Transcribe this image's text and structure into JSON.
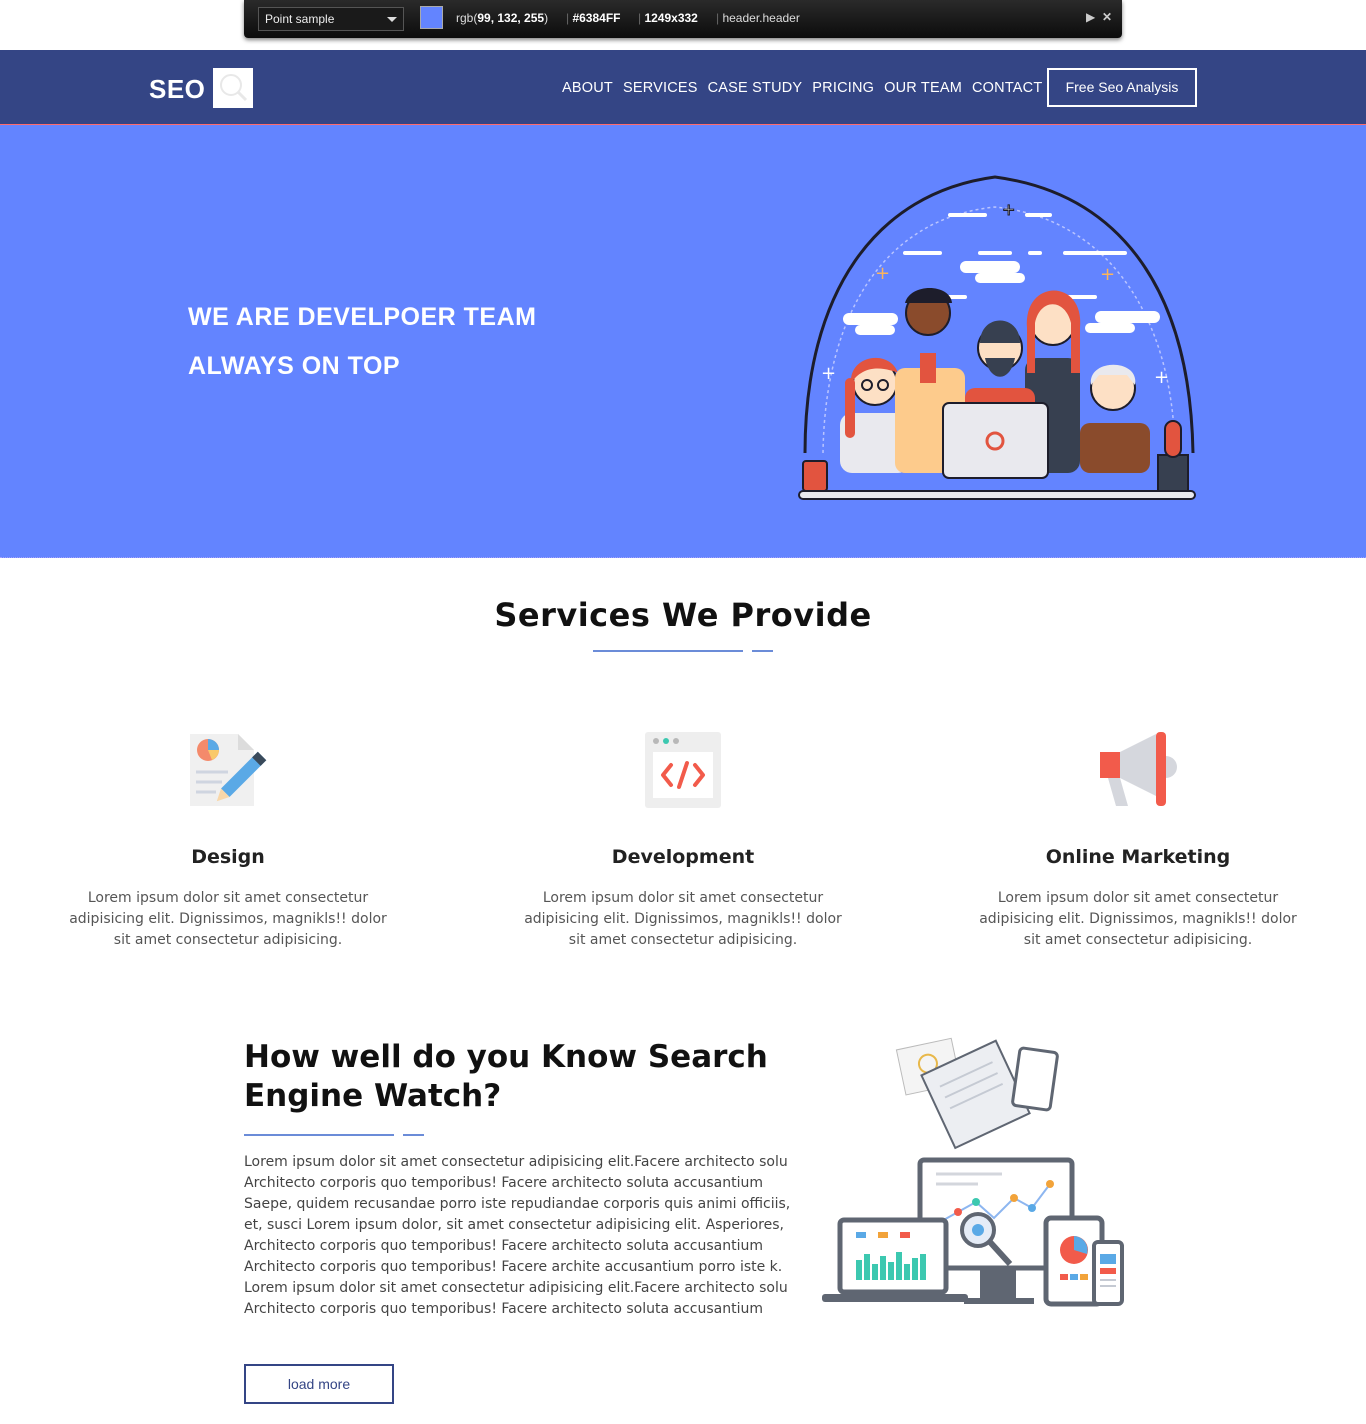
{
  "picker": {
    "mode": "Point sample",
    "rgb_prefix": "rgb(",
    "rgb_values": "99, 132, 255",
    "rgb_suffix": ")",
    "hex": "#6384FF",
    "size": "1249x332",
    "selector": "header.header",
    "swatch_color": "#6384FF"
  },
  "header": {
    "logo": "SEO",
    "nav": [
      "ABOUT",
      "SERVICES",
      "CASE STUDY",
      "PRICING",
      "OUR TEAM",
      "CONTACT"
    ],
    "cta": "Free Seo Analysis",
    "bg_color": "#344585"
  },
  "hero": {
    "line1": "WE ARE DEVELPOER TEAM",
    "line2": "ALWAYS ON TOP",
    "bg_color": "#6384FF"
  },
  "services": {
    "title": "Services We Provide",
    "items": [
      {
        "icon": "design-document-pencil-icon",
        "title": "Design",
        "text": "Lorem ipsum dolor sit amet consectetur adipisicing elit. Dignissimos, magnikls!! dolor sit amet consectetur adipisicing."
      },
      {
        "icon": "code-window-icon",
        "title": "Development",
        "text": "Lorem ipsum dolor sit amet consectetur adipisicing elit. Dignissimos, magnikls!! dolor sit amet consectetur adipisicing."
      },
      {
        "icon": "megaphone-icon",
        "title": "Online Marketing",
        "text": "Lorem ipsum dolor sit amet consectetur adipisicing elit. Dignissimos, magnikls!! dolor sit amet consectetur adipisicing."
      }
    ]
  },
  "know": {
    "title": "How well do you Know Search Engine Watch?",
    "text": "Lorem ipsum dolor sit amet consectetur adipisicing elit.Facere architecto solu Architecto corporis quo temporibus! Facere architecto soluta accusantium Saepe, quidem recusandae porro iste repudiandae corporis quis animi officiis, et, susci Lorem ipsum dolor, sit amet consectetur adipisicing elit. Asperiores, Architecto corporis quo temporibus! Facere architecto soluta accusantium Architecto corporis quo temporibus! Facere archite accusantium porro iste k. Lorem ipsum dolor sit amet consectetur adipisicing elit.Facere architecto solu Architecto corporis quo temporibus! Facere architecto soluta accusantium",
    "button": "load more"
  }
}
